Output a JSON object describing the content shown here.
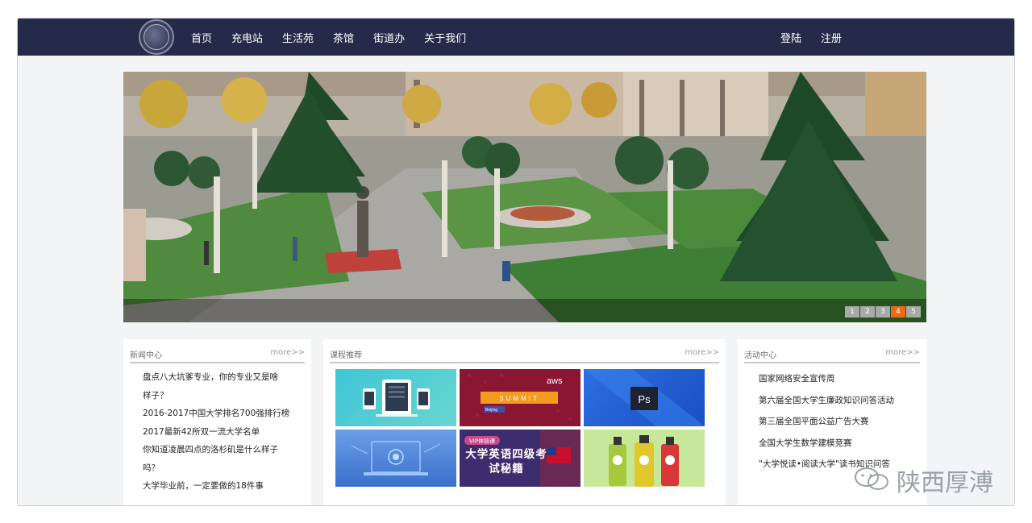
{
  "nav": {
    "links": [
      "首页",
      "充电站",
      "生活苑",
      "茶馆",
      "街道办",
      "关于我们"
    ],
    "login": "登陆",
    "register": "注册"
  },
  "banner": {
    "pages": [
      "1",
      "2",
      "3",
      "4",
      "5"
    ],
    "active_page": 4
  },
  "news": {
    "title": "新闻中心",
    "more": "more>>",
    "items": [
      "盘点八大坑爹专业，你的专业又是啥",
      "样子？",
      "2016-2017中国大学排名700强排行榜",
      "2017最新42所双一流大学名单",
      "你知道凌晨四点的洛杉矶是什么样子",
      "吗？",
      "大学毕业前，一定要做的18件事"
    ]
  },
  "courses": {
    "title": "课程推荐",
    "more": "more>>",
    "tiles": [
      {
        "label": "",
        "icon": "devices-icon"
      },
      {
        "label": "SUMMIT",
        "brand": "aws",
        "sub": "Beijing",
        "icon": "aws-summit-icon"
      },
      {
        "label": "Ps",
        "icon": "photoshop-icon"
      },
      {
        "label": "",
        "icon": "laptop-brain-icon"
      },
      {
        "label": "大学英语四级考试秘籍",
        "tag": "VIP体验课",
        "icon": "cet4-icon"
      },
      {
        "label": "",
        "icon": "drink-bottles-icon"
      }
    ]
  },
  "events": {
    "title": "活动中心",
    "more": "more>>",
    "items": [
      "国家网络安全宣传周",
      "第六届全国大学生廉政知识问答活动",
      "第三届全国平面公益广告大赛",
      "全国大学生数学建模竞赛",
      "\"大学悦读•阅读大学\"读书知识问答"
    ]
  },
  "watermark": "陕西厚溥"
}
